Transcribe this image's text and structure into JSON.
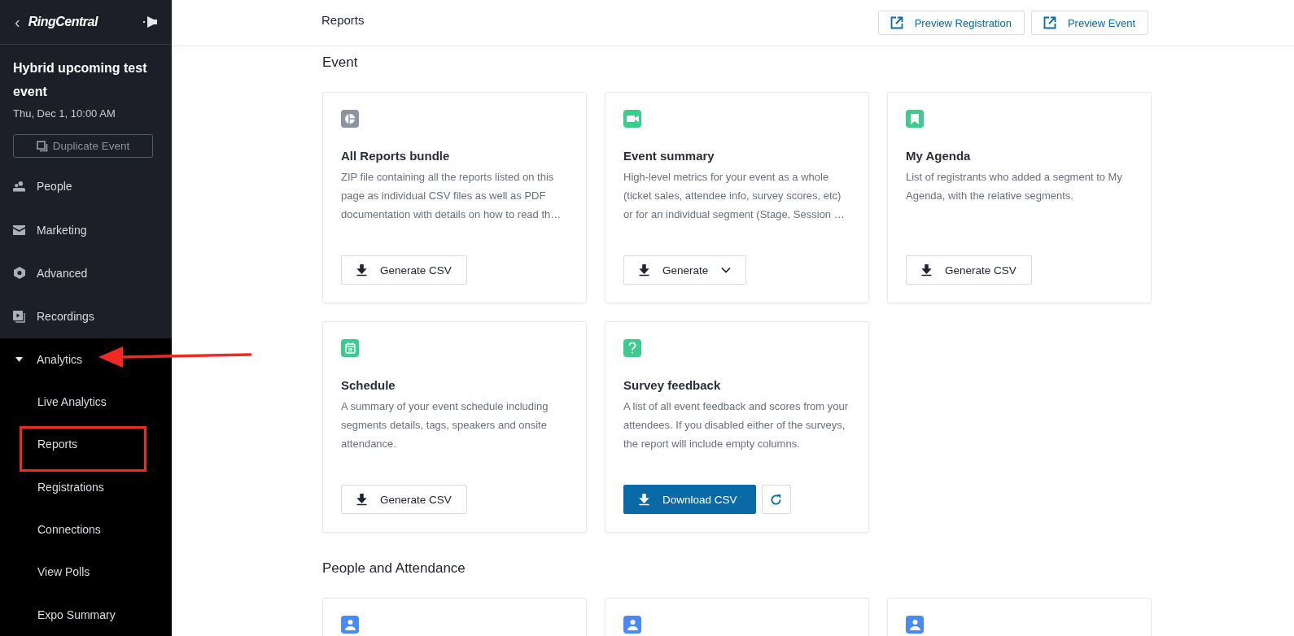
{
  "sidebar": {
    "back": "‹",
    "brand": "RingCentral",
    "event_title": "Hybrid upcoming test event",
    "event_date": "Thu, Dec 1, 10:00 AM",
    "duplicate_button": "Duplicate Event",
    "items": [
      {
        "label": "People",
        "expanded": false
      },
      {
        "label": "Marketing",
        "expanded": false
      },
      {
        "label": "Advanced",
        "expanded": false
      },
      {
        "label": "Recordings",
        "expanded": false
      },
      {
        "label": "Analytics",
        "expanded": true,
        "children": [
          {
            "label": "Live Analytics"
          },
          {
            "label": "Reports"
          },
          {
            "label": "Registrations"
          },
          {
            "label": "Connections"
          },
          {
            "label": "View Polls"
          },
          {
            "label": "Expo Summary"
          }
        ]
      }
    ]
  },
  "header": {
    "title": "Reports",
    "buttons": [
      "Preview Registration",
      "Preview Event"
    ]
  },
  "sections": [
    {
      "title": "Event",
      "cards": [
        {
          "color": "#8e93a0",
          "title": "All Reports bundle",
          "description": "ZIP file containing all the reports listed on this page as individual CSV files as well as PDF documentation with details on how to read th…",
          "action": {
            "kind": "outline",
            "label": "Generate CSV",
            "dropdown": false,
            "refresh": false
          }
        },
        {
          "color": "#3fcb8f",
          "title": "Event summary",
          "description": "High-level metrics for your event as a whole (ticket sales, attendee info, survey scores, etc) or for an individual segment (Stage, Session …",
          "action": {
            "kind": "outline",
            "label": "Generate",
            "dropdown": true,
            "refresh": false
          }
        },
        {
          "color": "#3fcb8f",
          "title": "My Agenda",
          "description": "List of registrants who added a segment to My Agenda, with the relative segments.",
          "action": {
            "kind": "outline",
            "label": "Generate CSV",
            "dropdown": false,
            "refresh": false
          }
        },
        {
          "color": "#3fcb8f",
          "title": "Schedule",
          "description": "A summary of your event schedule including segments details, tags, speakers and onsite attendance.",
          "action": {
            "kind": "outline",
            "label": "Generate CSV",
            "dropdown": false,
            "refresh": false
          }
        },
        {
          "color": "#3fcb8f",
          "title": "Survey feedback",
          "description": "A list of all event feedback and scores from your attendees. If you disabled either of the surveys, the report will include empty columns.",
          "action": {
            "kind": "primary",
            "label": "Download CSV",
            "dropdown": false,
            "refresh": true
          }
        }
      ]
    },
    {
      "title": "People and Attendance",
      "cards": [
        {
          "color": "#4a8af4"
        },
        {
          "color": "#4a8af4"
        },
        {
          "color": "#4a8af4"
        }
      ]
    }
  ]
}
